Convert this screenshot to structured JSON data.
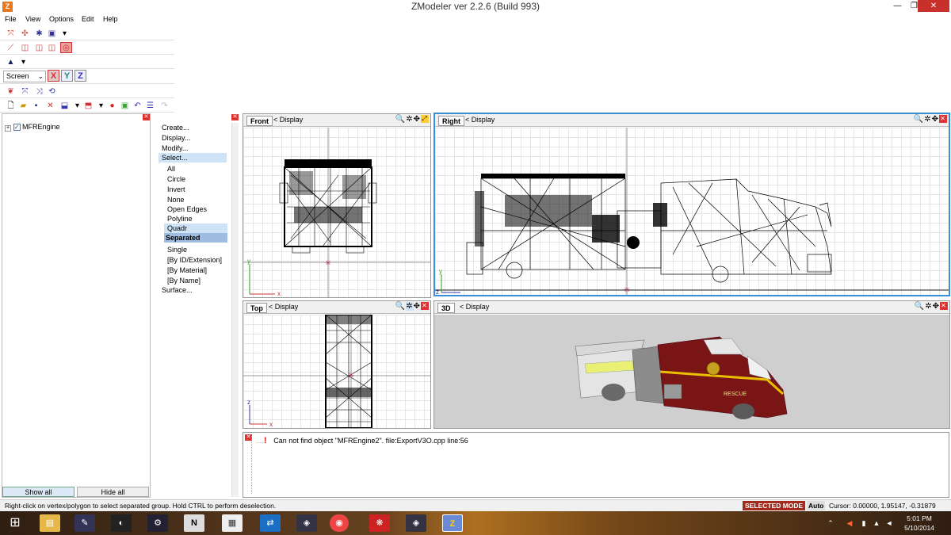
{
  "window": {
    "title": "ZModeler ver 2.2.6 (Build 993)",
    "app_icon": "Z",
    "minimize": "—",
    "restore": "❐",
    "close": "✕"
  },
  "menu": [
    "File",
    "View",
    "Options",
    "Edit",
    "Help"
  ],
  "toolbar": {
    "screen_mode": "Screen",
    "axis_x": "X",
    "axis_y": "Y",
    "axis_z": "Z"
  },
  "tree": {
    "items": [
      {
        "label": "MFREngine",
        "checked": true
      }
    ],
    "show_all": "Show all",
    "hide_all": "Hide all"
  },
  "commands": {
    "top": [
      "Create...",
      "Display...",
      "Modify...",
      "Select..."
    ],
    "select_options": [
      "All",
      "Circle",
      "Invert",
      "None",
      "Open Edges",
      "Polyline",
      "Quadr",
      "Separated",
      "Single",
      "[By ID/Extension]",
      "[By Material]",
      "[By Name]"
    ],
    "bottom": [
      "Surface..."
    ],
    "selected": "Separated"
  },
  "viewports": {
    "front": {
      "name": "Front",
      "display": "Display"
    },
    "right": {
      "name": "Right",
      "display": "Display"
    },
    "top": {
      "name": "Top",
      "display": "Display"
    },
    "3d": {
      "name": "3D",
      "display": "Display"
    },
    "axis_labels": {
      "x": "x",
      "y": "y",
      "z": "z"
    },
    "truck_text": "RESCUE"
  },
  "log": {
    "message": "Can not find object \"MFREngine2\". file:ExportV3O.cpp line:56"
  },
  "status": {
    "hint": "Right-click on vertex/polygon to select separated group. Hold CTRL to perform deselection.",
    "mode": "SELECTED MODE",
    "auto": "Auto",
    "cursor": "Cursor: 0.00000, 1.95147, -0.31879"
  },
  "taskbar": {
    "time": "5:01 PM",
    "date": "5/10/2014"
  },
  "colors": {
    "accent": "#3b8ed8",
    "selected_mode": "#a32a1a",
    "close_red": "#c7302b",
    "truck_red": "#7a1515"
  }
}
